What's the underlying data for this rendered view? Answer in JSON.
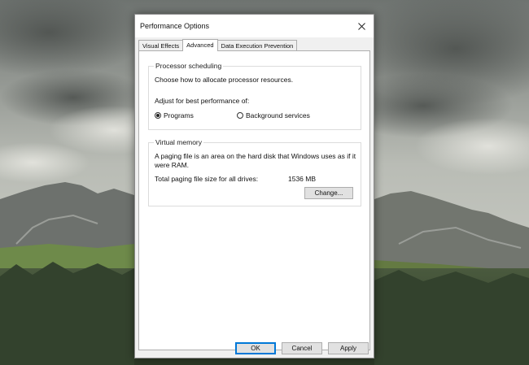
{
  "dialog": {
    "title": "Performance Options",
    "tabs": [
      {
        "label": "Visual Effects",
        "active": false
      },
      {
        "label": "Advanced",
        "active": true
      },
      {
        "label": "Data Execution Prevention",
        "active": false
      }
    ],
    "processor": {
      "legend": "Processor scheduling",
      "description": "Choose how to allocate processor resources.",
      "adjust_label": "Adjust for best performance of:",
      "options": [
        {
          "label": "Programs",
          "selected": true
        },
        {
          "label": "Background services",
          "selected": false
        }
      ]
    },
    "virtual_memory": {
      "legend": "Virtual memory",
      "description_line1": "A paging file is an area on the hard disk that Windows uses as if it",
      "description_line2": "were RAM.",
      "total_label": "Total paging file size for all drives:",
      "total_value": "1536 MB",
      "change_button": "Change..."
    },
    "buttons": {
      "ok": "OK",
      "cancel": "Cancel",
      "apply": "Apply"
    }
  },
  "icons": {
    "close": "close-icon"
  },
  "colors": {
    "accent": "#0078d7",
    "dialog_bg": "#f0f0f0",
    "panel_bg": "#ffffff"
  }
}
